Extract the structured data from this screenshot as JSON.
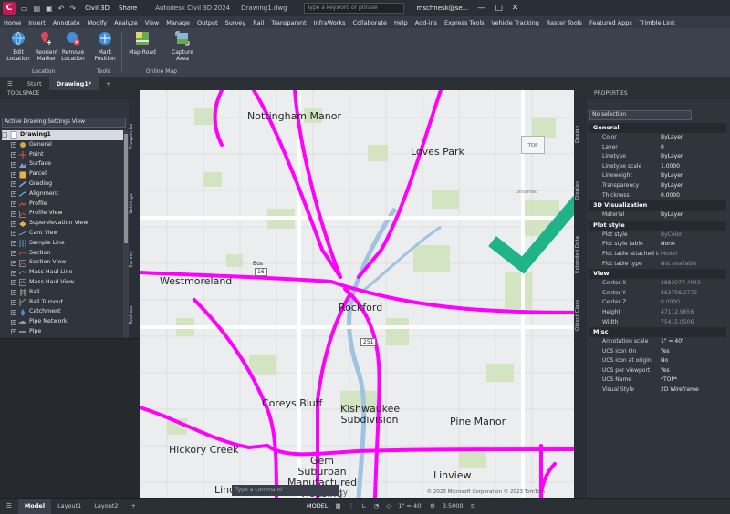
{
  "titlebar": {
    "app_logo": "C",
    "workspace": "Civil 3D",
    "share": "Share",
    "app_title": "Autodesk Civil 3D 2024",
    "doc_title": "Drawing1.dwg",
    "search_placeholder": "Type a keyword or phrase",
    "user": "mschnesk@se..."
  },
  "menu": [
    "Home",
    "Insert",
    "Annotate",
    "Modify",
    "Analyze",
    "View",
    "Manage",
    "Output",
    "Survey",
    "Rail",
    "Transparent",
    "InfraWorks",
    "Collaborate",
    "Help",
    "Add-ins",
    "Express Tools",
    "Vehicle Tracking",
    "Raster Tools",
    "Featured Apps",
    "Trimble Link"
  ],
  "ribbon": {
    "edit_location": "Edit Location",
    "reorient_marker": "Reorient Marker",
    "remove_location": "Remove Location",
    "mark_position": "Mark Position",
    "map_road": "Map Road",
    "capture_area": "Capture Area",
    "panels": {
      "location": "Location",
      "tools": "Tools",
      "online_map": "Online Map"
    }
  },
  "doc_tabs": {
    "start": "Start",
    "drawing": "Drawing1*"
  },
  "toolspace": {
    "title": "TOOLSPACE",
    "view": "Active Drawing Settings View",
    "root": "Drawing1",
    "items": [
      "General",
      "Point",
      "Surface",
      "Parcel",
      "Grading",
      "Alignment",
      "Profile",
      "Profile View",
      "Superelevation View",
      "Cant View",
      "Sample Line",
      "Section",
      "Section View",
      "Mass Haul Line",
      "Mass Haul View",
      "Rail",
      "Rail Turnout",
      "Catchment",
      "Pipe Network",
      "Pipe"
    ],
    "side_tabs": [
      "Prospector",
      "Settings",
      "Survey",
      "Toolbox"
    ]
  },
  "map": {
    "labels": {
      "nottingham": "Nottingham Manor",
      "loves_park": "Loves Park",
      "westmoreland": "Westmoreland",
      "rockford": "Rockford",
      "coreys_bluff": "Coreys Bluff",
      "kishwaukee": "Kishwaukee Subdivision",
      "pine_manor": "Pine Manor",
      "hickory_creek": "Hickory Creek",
      "gem_suburban": "Gem Suburban Manufactured Housing",
      "linview": "Linview",
      "linde": "Linde",
      "bus": "Bus",
      "route_16": "16",
      "route_251": "251",
      "unnamed": "Unnamed",
      "community": "Community"
    },
    "viewcube": "TOP",
    "copyright": "© 2023 Microsoft Corporation © 2023 TomTom",
    "command_placeholder": "Type a command"
  },
  "right_side_tabs": [
    "Design",
    "Display",
    "Extended Data",
    "Object Class"
  ],
  "properties": {
    "title": "PROPERTIES",
    "selection": "No selection",
    "sections": [
      {
        "name": "General",
        "rows": [
          [
            "Color",
            "ByLayer"
          ],
          [
            "Layer",
            "0"
          ],
          [
            "Linetype",
            "ByLayer"
          ],
          [
            "Linetype scale",
            "1.0000"
          ],
          [
            "Lineweight",
            "ByLayer"
          ],
          [
            "Transparency",
            "ByLayer"
          ],
          [
            "Thickness",
            "0.0000"
          ]
        ]
      },
      {
        "name": "3D Visualization",
        "rows": [
          [
            "Material",
            "ByLayer"
          ]
        ]
      },
      {
        "name": "Plot style",
        "rows": [
          [
            "Plot style",
            "ByColor"
          ],
          [
            "Plot style table",
            "None"
          ],
          [
            "Plot table attached to",
            "Model"
          ],
          [
            "Plot table type",
            "Not available"
          ]
        ]
      },
      {
        "name": "View",
        "rows": [
          [
            "Center X",
            "2883077.4042"
          ],
          [
            "Center Y",
            "863798.2772"
          ],
          [
            "Center Z",
            "0.0000"
          ],
          [
            "Height",
            "47112.9656"
          ],
          [
            "Width",
            "75415.0506"
          ]
        ]
      },
      {
        "name": "Misc",
        "rows": [
          [
            "Annotation scale",
            "1\" = 40'"
          ],
          [
            "UCS icon On",
            "Yes"
          ],
          [
            "UCS icon at origin",
            "No"
          ],
          [
            "UCS per viewport",
            "Yes"
          ],
          [
            "UCS Name",
            "*TOP*"
          ],
          [
            "Visual Style",
            "2D Wireframe"
          ]
        ]
      }
    ]
  },
  "statusbar": {
    "tabs": [
      "Model",
      "Layout1",
      "Layout2"
    ],
    "model_label": "MODEL",
    "scale": "1\" = 40'",
    "value": "3.5000"
  },
  "colors": {
    "road": "#ff00ff",
    "check": "#1fb38a",
    "highway_fill": "#ffffff"
  }
}
